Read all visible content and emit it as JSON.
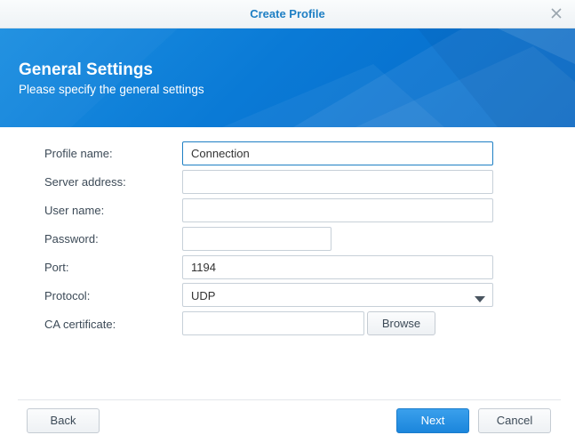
{
  "window": {
    "title": "Create Profile",
    "close_icon": "close-icon"
  },
  "banner": {
    "heading": "General Settings",
    "subheading": "Please specify the general settings",
    "color": "#0a7ad6"
  },
  "form": {
    "profile_name": {
      "label": "Profile name:",
      "value": "Connection"
    },
    "server_address": {
      "label": "Server address:",
      "value": ""
    },
    "user_name": {
      "label": "User name:",
      "value": ""
    },
    "password": {
      "label": "Password:",
      "value": ""
    },
    "port": {
      "label": "Port:",
      "value": "1194"
    },
    "protocol": {
      "label": "Protocol:",
      "value": "UDP"
    },
    "ca_certificate": {
      "label": "CA certificate:",
      "value": "",
      "browse_label": "Browse"
    }
  },
  "footer": {
    "back_label": "Back",
    "next_label": "Next",
    "cancel_label": "Cancel"
  }
}
